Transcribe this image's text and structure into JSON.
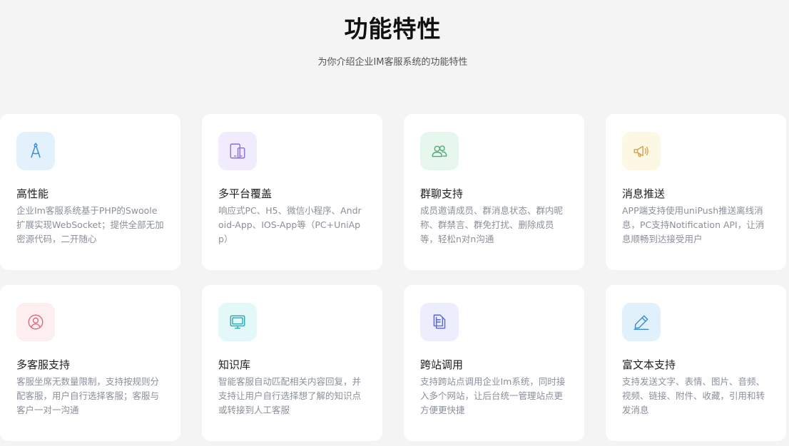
{
  "header": {
    "title": "功能特性",
    "subtitle": "为你介绍企业IM客服系统的功能特性"
  },
  "features": [
    {
      "title": "高性能",
      "desc": "企业Im客服系统基于PHP的Swoole扩展实现WebSocket；提供全部无加密源代码，二开随心",
      "icon": "compass-icon",
      "icon_bg": "#e3f1fd",
      "icon_color": "#3a8fd6"
    },
    {
      "title": "多平台覆盖",
      "desc": "响应式PC、H5、微信小程序、Android-App、IOS-App等（PC+UniApp）",
      "icon": "devices-icon",
      "icon_bg": "#f0ebfd",
      "icon_color": "#8b6fe0"
    },
    {
      "title": "群聊支持",
      "desc": "成员邀请成员、群消息状态、群内昵称、群禁言、群免打扰、删除成员等，轻松n对n沟通",
      "icon": "users-icon",
      "icon_bg": "#e8f7ee",
      "icon_color": "#4bae74"
    },
    {
      "title": "消息推送",
      "desc": "APP端支持使用uniPush推送离线消息，PC支持Notification API，让消息顺畅到达接受用户",
      "icon": "megaphone-icon",
      "icon_bg": "#fdf8e3",
      "icon_color": "#d9a34a"
    },
    {
      "title": "多客服支持",
      "desc": "客服坐席无数量限制，支持按规则分配客服，用户自行选择客服；客服与客户一对一沟通",
      "icon": "user-circle-icon",
      "icon_bg": "#fdeef0",
      "icon_color": "#dd6b80"
    },
    {
      "title": "知识库",
      "desc": "智能客服自动匹配相关内容回复，并支持让用户自行选择想了解的知识点或转接到人工客服",
      "icon": "monitor-icon",
      "icon_bg": "#e2f8f9",
      "icon_color": "#2aa9b3"
    },
    {
      "title": "跨站调用",
      "desc": "支持跨站点调用企业Im系统，同时接入多个网站，让后台统一管理站点更方便更快捷",
      "icon": "documents-icon",
      "icon_bg": "#eceefd",
      "icon_color": "#5d68d6"
    },
    {
      "title": "富文本支持",
      "desc": "支持发送文字、表情、图片、音频、视频、链接、附件、收藏，引用和转发消息",
      "icon": "pencil-icon",
      "icon_bg": "#e1f1fc",
      "icon_color": "#3b8bcd"
    }
  ]
}
